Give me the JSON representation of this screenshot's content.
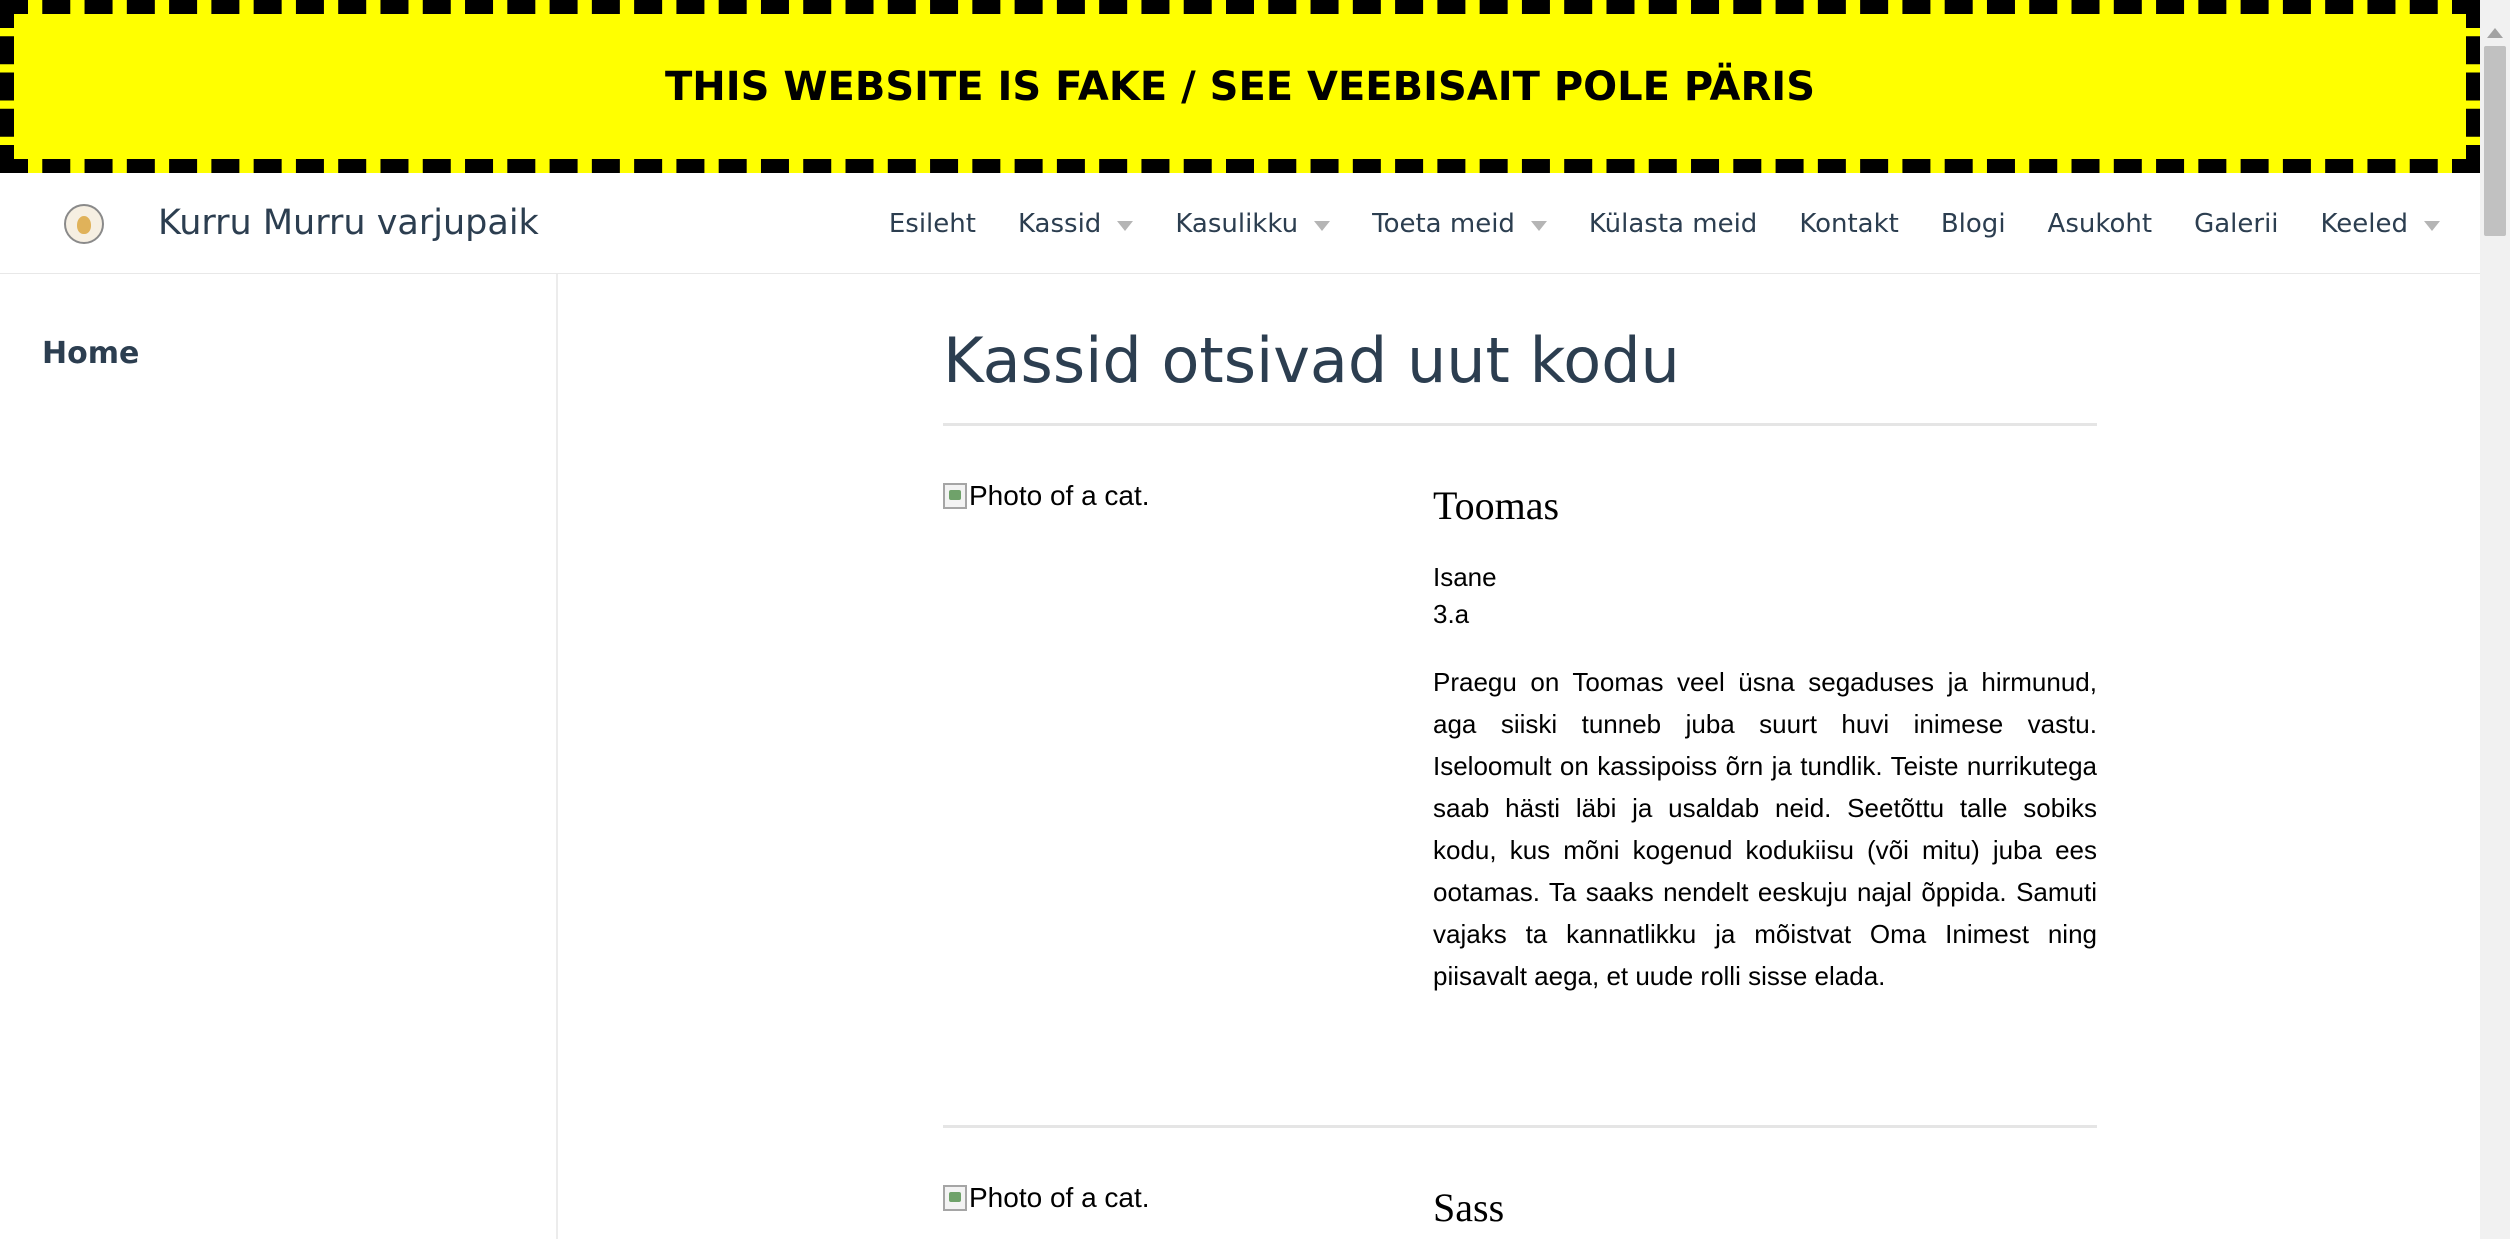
{
  "banner": {
    "text": "THIS WEBSITE IS FAKE / SEE VEEBISAIT POLE PÄRIS"
  },
  "header": {
    "logo_icon": "cat-shelter-logo-icon",
    "site_title": "Kurru Murru varjupaik",
    "nav": [
      {
        "label": "Esileht",
        "dropdown": false
      },
      {
        "label": "Kassid",
        "dropdown": true
      },
      {
        "label": "Kasulikku",
        "dropdown": true
      },
      {
        "label": "Toeta meid",
        "dropdown": true
      },
      {
        "label": "Külasta meid",
        "dropdown": false
      },
      {
        "label": "Kontakt",
        "dropdown": false
      },
      {
        "label": "Blogi",
        "dropdown": false
      },
      {
        "label": "Asukoht",
        "dropdown": false
      },
      {
        "label": "Galerii",
        "dropdown": false
      },
      {
        "label": "Keeled",
        "dropdown": true
      }
    ]
  },
  "sidebar": {
    "home_label": "Home"
  },
  "main": {
    "title": "Kassid otsivad uut kodu",
    "cats": [
      {
        "photo_alt": "Photo of a cat.",
        "name": "Toomas",
        "sex": "Isane",
        "age": "3.a",
        "description": "Praegu on Toomas veel üsna segaduses ja hirmunud, aga siiski tunneb juba suurt huvi inimese vastu. Iseloomult on kassipoiss õrn ja tundlik. Teiste nurrikutega saab hästi läbi ja usaldab neid. Seetõttu talle sobiks kodu, kus mõni kogenud kodukiisu (või mitu) juba ees ootamas. Ta saaks nendelt eeskuju najal õppida. Samuti vajaks ta kannatlikku ja mõistvat Oma Inimest ning piisavalt aega, et uude rolli sisse elada."
      },
      {
        "photo_alt": "Photo of a cat.",
        "name": "Sass"
      }
    ]
  },
  "colors": {
    "banner_bg": "#ffff00",
    "banner_border": "#000000",
    "text_primary": "#2c3e50"
  }
}
